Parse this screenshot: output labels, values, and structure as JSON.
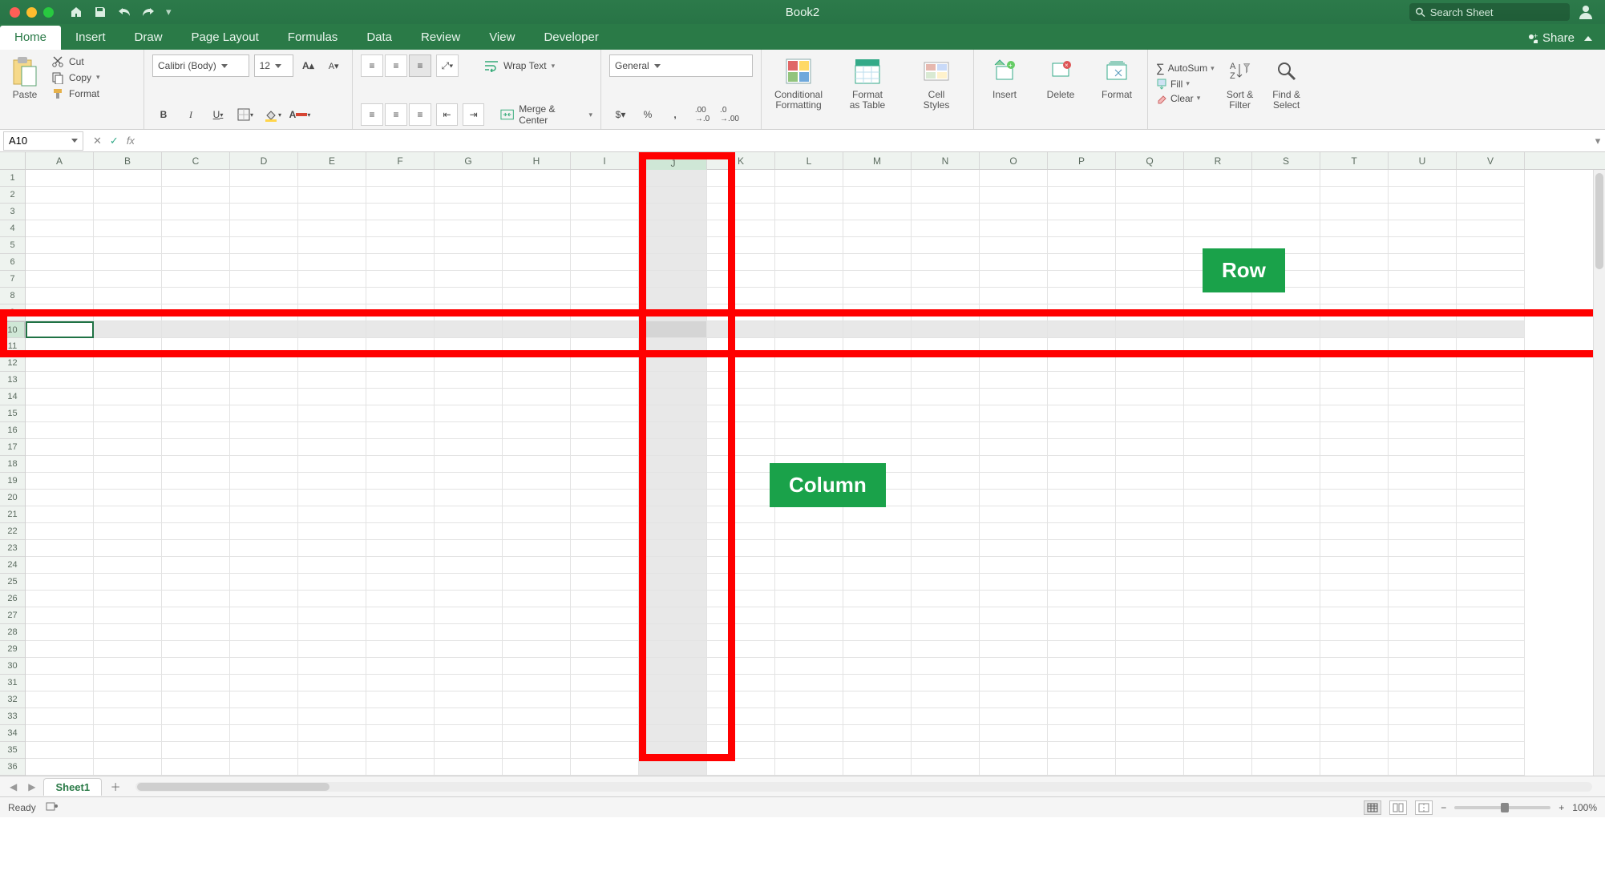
{
  "title": "Book2",
  "search_placeholder": "Search Sheet",
  "tabs": [
    "Home",
    "Insert",
    "Draw",
    "Page Layout",
    "Formulas",
    "Data",
    "Review",
    "View",
    "Developer"
  ],
  "active_tab": "Home",
  "share_label": "Share",
  "clipboard": {
    "cut": "Cut",
    "copy": "Copy",
    "format_painter": "Format",
    "paste": "Paste"
  },
  "font": {
    "name": "Calibri (Body)",
    "size": "12"
  },
  "alignment": {
    "wrap": "Wrap Text",
    "merge": "Merge & Center"
  },
  "number": {
    "format": "General"
  },
  "styles": {
    "cond": "Conditional\nFormatting",
    "table": "Format\nas Table",
    "cell": "Cell\nStyles"
  },
  "cells": {
    "insert": "Insert",
    "delete": "Delete",
    "format": "Format"
  },
  "editing": {
    "autosum": "AutoSum",
    "fill": "Fill",
    "clear": "Clear",
    "sort": "Sort &\nFilter",
    "find": "Find &\nSelect"
  },
  "namebox": "A10",
  "fx_label": "fx",
  "columns": [
    "A",
    "B",
    "C",
    "D",
    "E",
    "F",
    "G",
    "H",
    "I",
    "J",
    "K",
    "L",
    "M",
    "N",
    "O",
    "P",
    "Q",
    "R",
    "S",
    "T",
    "U",
    "V"
  ],
  "rows": [
    1,
    2,
    3,
    4,
    5,
    6,
    7,
    8,
    9,
    10,
    11,
    12,
    13,
    14,
    15,
    16,
    17,
    18,
    19,
    20,
    21,
    22,
    23,
    24,
    25,
    26,
    27,
    28,
    29,
    30,
    31,
    32,
    33,
    34,
    35,
    36
  ],
  "selected_column": "J",
  "selected_row": 10,
  "annotations": {
    "row_label": "Row",
    "column_label": "Column"
  },
  "sheet_tabs": [
    "Sheet1"
  ],
  "status": {
    "ready": "Ready",
    "zoom": "100%"
  }
}
